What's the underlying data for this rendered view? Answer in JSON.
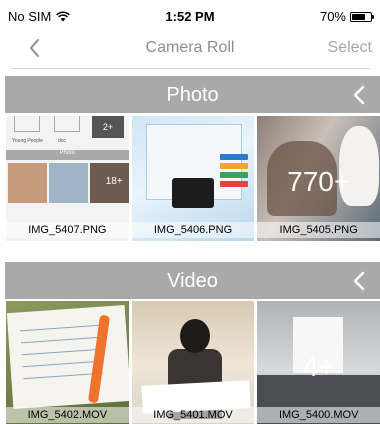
{
  "status_bar": {
    "carrier": "No SIM",
    "wifi_icon": "wifi-icon",
    "time": "1:52 PM",
    "battery_percent": "70%",
    "battery_level": 0.7
  },
  "nav": {
    "back_icon": "chevron-left-icon",
    "title": "Camera Roll",
    "select_label": "Select"
  },
  "sections": {
    "photo": {
      "title": "Photo",
      "collapse_icon": "chevron-left-icon",
      "items": [
        {
          "name": "IMG_5407.PNG"
        },
        {
          "name": "IMG_5406.PNG"
        },
        {
          "name": "IMG_5405.PNG",
          "more_count": "770+"
        }
      ]
    },
    "video": {
      "title": "Video",
      "collapse_icon": "chevron-left-icon",
      "items": [
        {
          "name": "IMG_5402.MOV"
        },
        {
          "name": "IMG_5401.MOV"
        },
        {
          "name": "IMG_5400.MOV",
          "more_count": "4+"
        }
      ]
    }
  },
  "colors": {
    "section_header": "#a9a9a9",
    "nav_title": "#8e8e8e",
    "select": "#a6a6a6"
  }
}
